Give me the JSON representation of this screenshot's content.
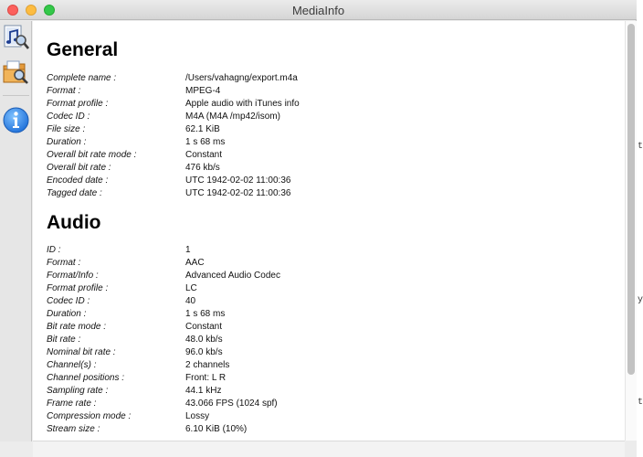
{
  "window": {
    "title": "MediaInfo"
  },
  "toolbar": {
    "buttons": [
      {
        "name": "music-file-icon"
      },
      {
        "name": "folder-search-icon"
      },
      {
        "name": "info-icon"
      }
    ]
  },
  "general": {
    "heading": "General",
    "rows": [
      {
        "label": "Complete name :",
        "value": "/Users/vahagng/export.m4a"
      },
      {
        "label": "Format :",
        "value": "MPEG-4"
      },
      {
        "label": "Format profile :",
        "value": "Apple audio with iTunes info"
      },
      {
        "label": "Codec ID :",
        "value": "M4A (M4A /mp42/isom)"
      },
      {
        "label": "File size :",
        "value": "62.1 KiB"
      },
      {
        "label": "Duration :",
        "value": "1 s 68 ms"
      },
      {
        "label": "Overall bit rate mode :",
        "value": "Constant"
      },
      {
        "label": "Overall bit rate :",
        "value": "476 kb/s"
      },
      {
        "label": "Encoded date :",
        "value": "UTC 1942-02-02 11:00:36"
      },
      {
        "label": "Tagged date :",
        "value": "UTC 1942-02-02 11:00:36"
      }
    ]
  },
  "audio": {
    "heading": "Audio",
    "rows": [
      {
        "label": "ID :",
        "value": "1"
      },
      {
        "label": "Format :",
        "value": "AAC"
      },
      {
        "label": "Format/Info :",
        "value": "Advanced Audio Codec"
      },
      {
        "label": "Format profile :",
        "value": "LC"
      },
      {
        "label": "Codec ID :",
        "value": "40"
      },
      {
        "label": "Duration :",
        "value": "1 s 68 ms"
      },
      {
        "label": "Bit rate mode :",
        "value": "Constant"
      },
      {
        "label": "Bit rate :",
        "value": "48.0 kb/s"
      },
      {
        "label": "Nominal bit rate :",
        "value": "96.0 kb/s"
      },
      {
        "label": "Channel(s) :",
        "value": "2 channels"
      },
      {
        "label": "Channel positions :",
        "value": "Front: L R"
      },
      {
        "label": "Sampling rate :",
        "value": "44.1 kHz"
      },
      {
        "label": "Frame rate :",
        "value": "43.066 FPS (1024 spf)"
      },
      {
        "label": "Compression mode :",
        "value": "Lossy"
      },
      {
        "label": "Stream size :",
        "value": "6.10 KiB (10%)"
      }
    ]
  },
  "background_window": {
    "fragments": [
      "te",
      "y",
      "te"
    ]
  }
}
